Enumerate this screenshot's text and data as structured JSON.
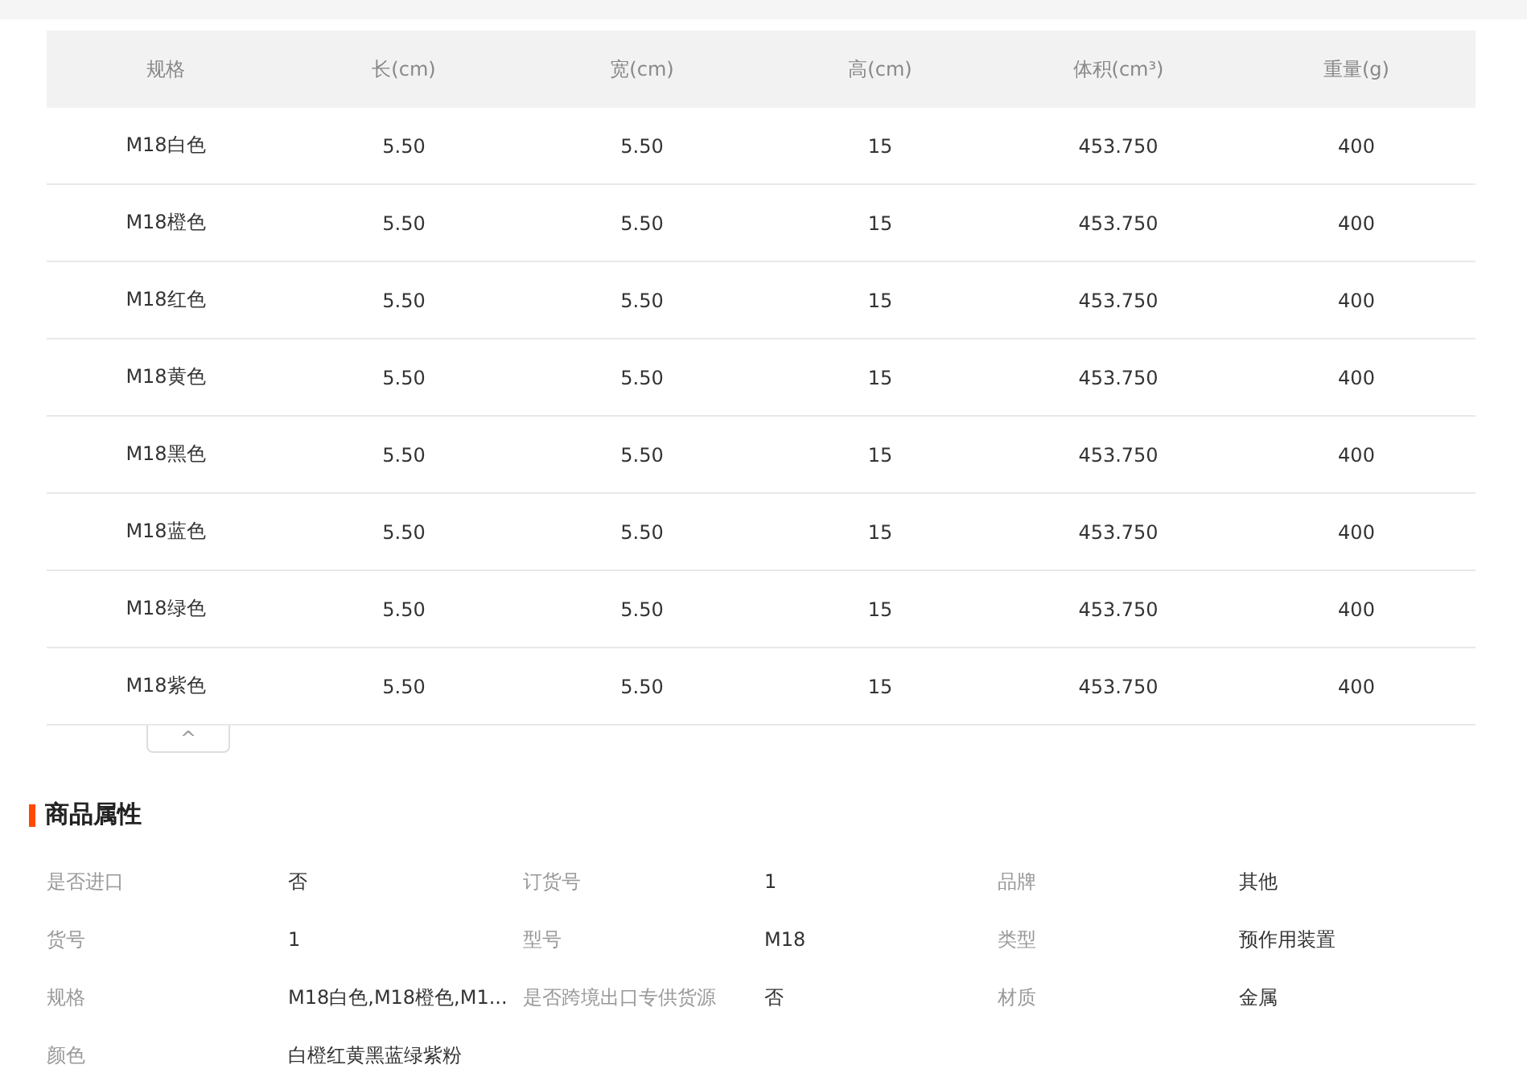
{
  "spec_table": {
    "columns": [
      "规格",
      "长(cm)",
      "宽(cm)",
      "高(cm)",
      "体积(cm³)",
      "重量(g)"
    ],
    "rows": [
      [
        "M18白色",
        "5.50",
        "5.50",
        "15",
        "453.750",
        "400"
      ],
      [
        "M18橙色",
        "5.50",
        "5.50",
        "15",
        "453.750",
        "400"
      ],
      [
        "M18红色",
        "5.50",
        "5.50",
        "15",
        "453.750",
        "400"
      ],
      [
        "M18黄色",
        "5.50",
        "5.50",
        "15",
        "453.750",
        "400"
      ],
      [
        "M18黑色",
        "5.50",
        "5.50",
        "15",
        "453.750",
        "400"
      ],
      [
        "M18蓝色",
        "5.50",
        "5.50",
        "15",
        "453.750",
        "400"
      ],
      [
        "M18绿色",
        "5.50",
        "5.50",
        "15",
        "453.750",
        "400"
      ],
      [
        "M18紫色",
        "5.50",
        "5.50",
        "15",
        "453.750",
        "400"
      ]
    ],
    "collapse_button": {
      "icon": "^"
    }
  },
  "attributes": {
    "title": "商品属性",
    "items": [
      {
        "label": "是否进口",
        "value": "否"
      },
      {
        "label": "订货号",
        "value": "1"
      },
      {
        "label": "品牌",
        "value": "其他"
      },
      {
        "label": "货号",
        "value": "1"
      },
      {
        "label": "型号",
        "value": "M18"
      },
      {
        "label": "类型",
        "value": "预作用装置"
      },
      {
        "label": "规格",
        "value": "M18白色,M18橙色,M1..."
      },
      {
        "label": "是否跨境出口专供货源",
        "value": "否"
      },
      {
        "label": "材质",
        "value": "金属"
      },
      {
        "label": "颜色",
        "value": "白橙红黄黑蓝绿紫粉"
      }
    ]
  }
}
